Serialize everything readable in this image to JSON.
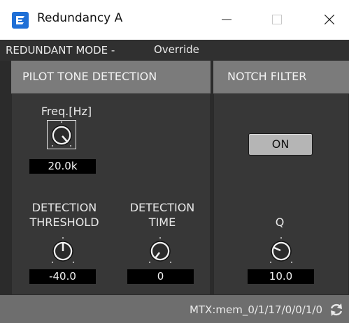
{
  "window": {
    "title": "Redundancy A",
    "controls": [
      "minimize",
      "maximize",
      "close"
    ]
  },
  "mode": {
    "label": "REDUNDANT MODE -",
    "value": "Override"
  },
  "pilot_tone": {
    "header": "PILOT TONE DETECTION",
    "freq": {
      "label": "Freq.[Hz]",
      "value": "20.0k"
    },
    "threshold": {
      "label_line1": "DETECTION",
      "label_line2": "THRESHOLD",
      "value": "-40.0"
    },
    "time": {
      "label_line1": "DETECTION",
      "label_line2": "TIME",
      "value": "0"
    }
  },
  "notch_filter": {
    "header": "NOTCH FILTER",
    "on_button": "ON",
    "q": {
      "label": "Q",
      "value": "10.0"
    }
  },
  "footer": {
    "path": "MTX:mem_0/1/17/0/0/1/0",
    "refresh_icon": "refresh-icon"
  },
  "colors": {
    "panel_bg": "#373737",
    "header_bg": "#7b7b7b",
    "accent_blue": "#1f6fd6"
  }
}
